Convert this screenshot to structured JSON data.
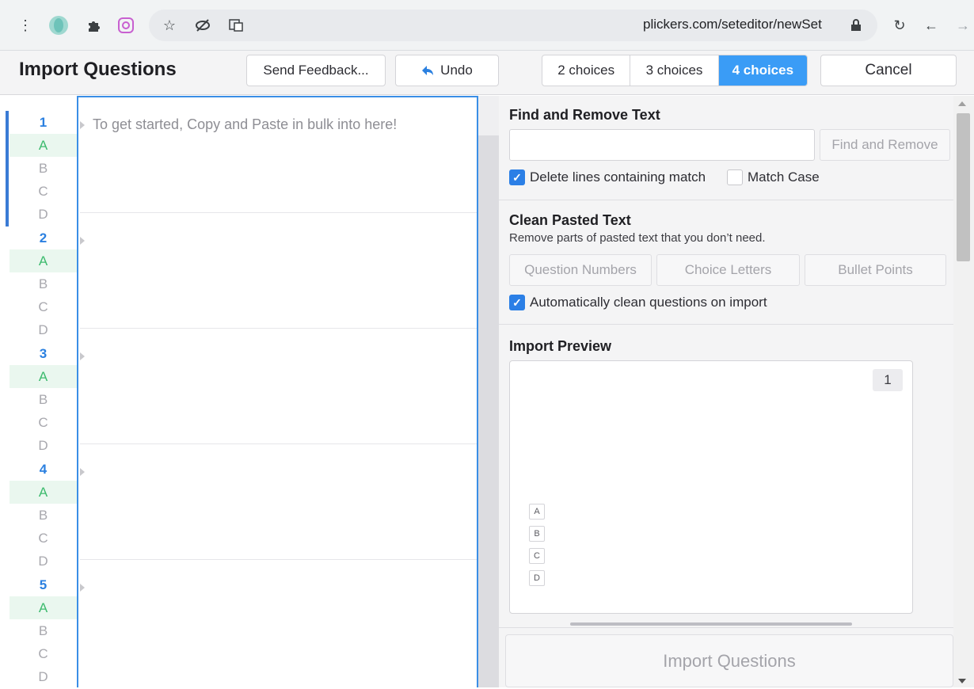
{
  "browser": {
    "url": "plickers.com/seteditor/newSet"
  },
  "toolbar": {
    "title": "Import Questions",
    "send_feedback": "Send Feedback...",
    "undo": "Undo",
    "choices": [
      "2 choices",
      "3 choices",
      "4 choices"
    ],
    "selected_choice": "4 choices",
    "cancel": "Cancel"
  },
  "editor": {
    "placeholder": "To get started, Copy and Paste in bulk into here!",
    "questions": [
      {
        "number": "1",
        "letters": [
          "A",
          "B",
          "C",
          "D"
        ]
      },
      {
        "number": "2",
        "letters": [
          "A",
          "B",
          "C",
          "D"
        ]
      },
      {
        "number": "3",
        "letters": [
          "A",
          "B",
          "C",
          "D"
        ]
      },
      {
        "number": "4",
        "letters": [
          "A",
          "B",
          "C",
          "D"
        ]
      },
      {
        "number": "5",
        "letters": [
          "A",
          "B",
          "C",
          "D"
        ]
      }
    ]
  },
  "find_remove": {
    "title": "Find and Remove Text",
    "input_value": "",
    "button": "Find and Remove",
    "delete_lines_label": "Delete lines containing match",
    "delete_lines_checked": true,
    "match_case_label": "Match Case",
    "match_case_checked": false
  },
  "clean": {
    "title": "Clean Pasted Text",
    "subtitle": "Remove parts of pasted text that you don’t need.",
    "buttons": [
      "Question Numbers",
      "Choice Letters",
      "Bullet Points"
    ],
    "auto_label": "Automatically clean questions on import",
    "auto_checked": true
  },
  "preview": {
    "title": "Import Preview",
    "question_number": "1",
    "choices": [
      "A",
      "B",
      "C",
      "D"
    ]
  },
  "import_button": "Import Questions",
  "colors": {
    "accent": "#3a9cf6",
    "number_blue": "#2b80e0",
    "answer_green": "#3dbb6e"
  }
}
